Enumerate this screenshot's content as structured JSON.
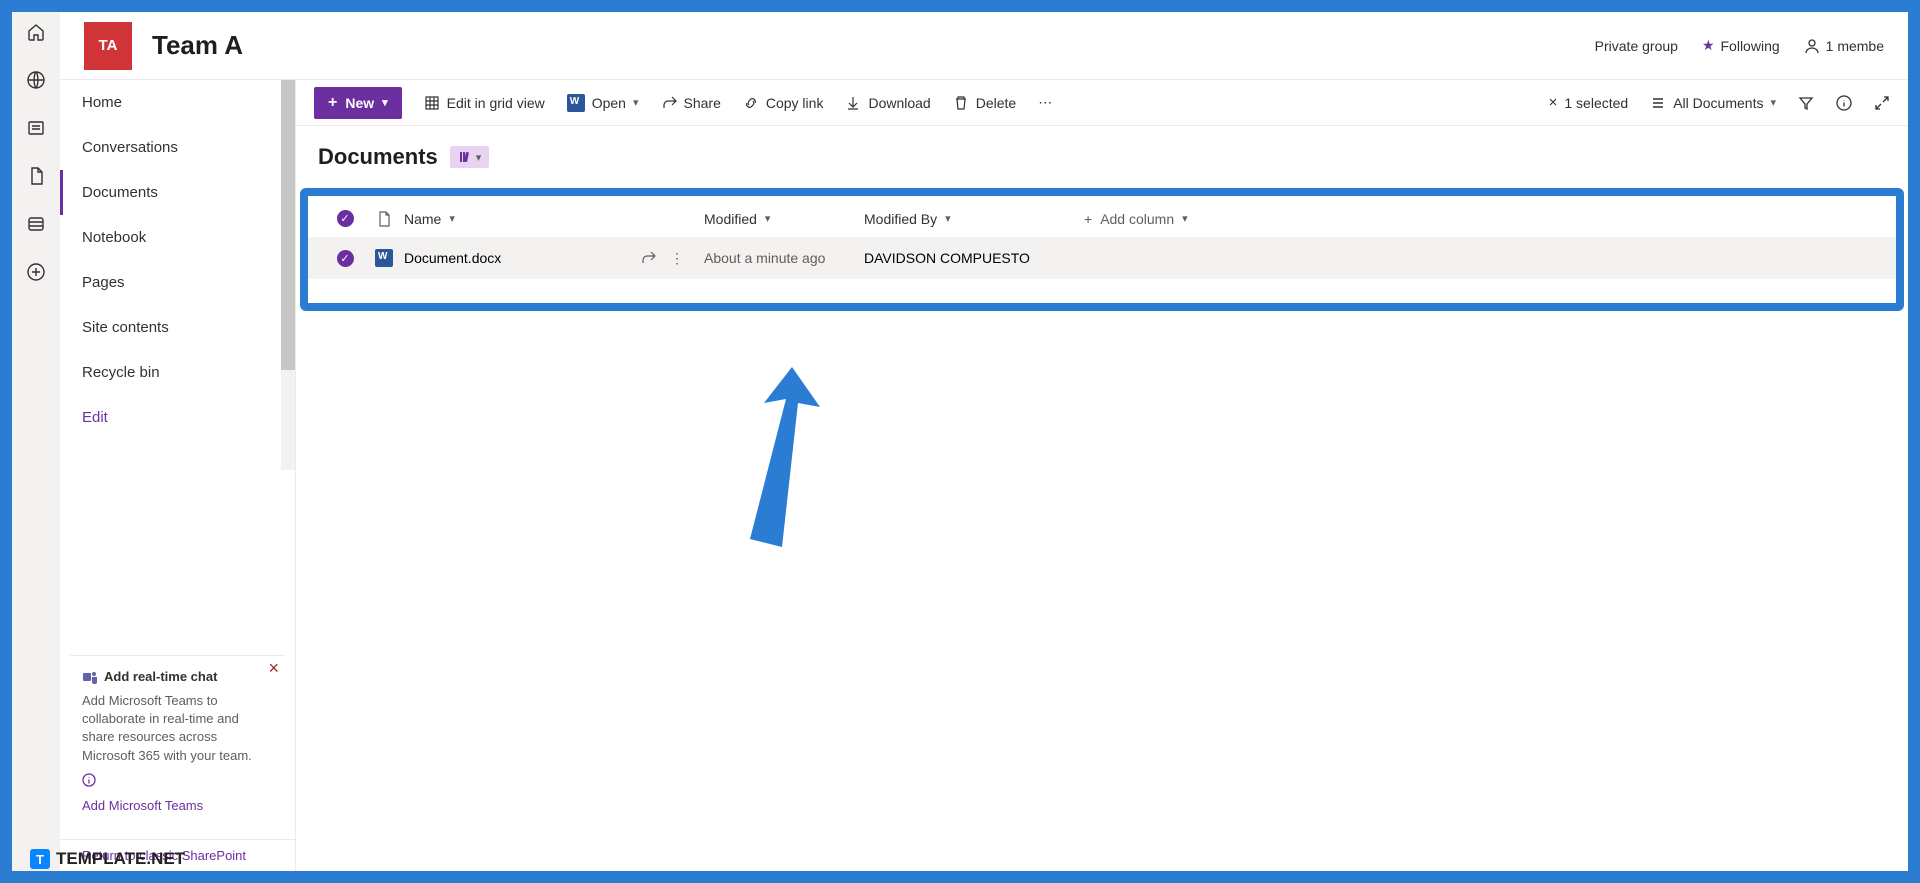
{
  "header": {
    "logo_text": "TA",
    "title": "Team A",
    "group_type": "Private group",
    "follow_label": "Following",
    "member_count": "1 membe"
  },
  "rail": [
    "home",
    "globe",
    "news",
    "file",
    "list",
    "plus"
  ],
  "sidebar": {
    "items": [
      {
        "label": "Home"
      },
      {
        "label": "Conversations"
      },
      {
        "label": "Documents",
        "active": true
      },
      {
        "label": "Notebook"
      },
      {
        "label": "Pages"
      },
      {
        "label": "Site contents"
      },
      {
        "label": "Recycle bin"
      },
      {
        "label": "Edit",
        "edit": true
      }
    ],
    "promo": {
      "title": "Add real-time chat",
      "body": "Add Microsoft Teams to collaborate in real-time and share resources across Microsoft 365 with your team.",
      "link": "Add Microsoft Teams"
    },
    "return_link": "Return to classic SharePoint"
  },
  "toolbar": {
    "new_label": "New",
    "edit_grid": "Edit in grid view",
    "open": "Open",
    "share": "Share",
    "copy": "Copy link",
    "download": "Download",
    "delete": "Delete",
    "selected": "1 selected",
    "view_label": "All Documents"
  },
  "page": {
    "title": "Documents"
  },
  "table": {
    "headers": {
      "name": "Name",
      "modified": "Modified",
      "by": "Modified By",
      "add": "Add column"
    },
    "rows": [
      {
        "name": "Document.docx",
        "modified": "About a minute ago",
        "by": "DAVIDSON COMPUESTO"
      }
    ]
  },
  "watermark": "TEMPLATE.NET"
}
